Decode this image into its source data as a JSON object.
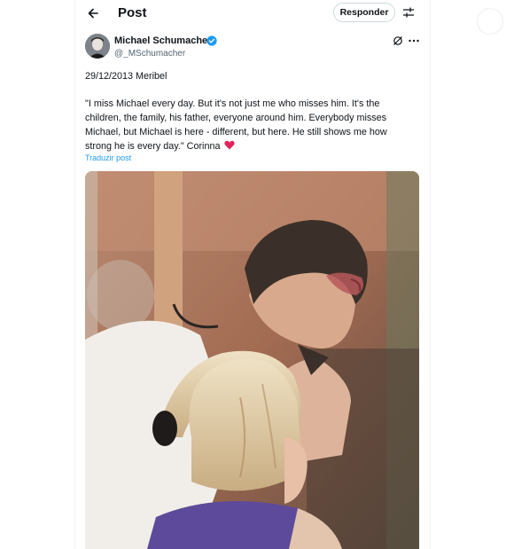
{
  "header": {
    "title": "Post",
    "reply_label": "Responder"
  },
  "post": {
    "author_name": "Michael Schumacher",
    "author_handle": "@_MSchumacher",
    "date_line": "29/12/2013 Meribel",
    "body_lines": [
      "\"I miss Michael every day. But it's not just me who misses him. It's the",
      "children, the family, his father, everyone around him. Everybody misses",
      "Michael, but Michael is here - different, but here. He still shows me how",
      "strong he is every day.\" Corinna"
    ],
    "translate_label": "Traduzir post"
  },
  "icons": {
    "back": "arrow-left-icon",
    "settings": "sliders-icon",
    "verified": "verified-badge-icon",
    "grok": "grok-icon",
    "more": "more-horizontal-icon",
    "heart": "heart-icon",
    "faded": "circle-icon"
  },
  "colors": {
    "accent": "#1d9bf0",
    "heart": "#e0245e",
    "text": "#0f1419",
    "secondary_text": "#536471",
    "border": "#eff3f4"
  }
}
